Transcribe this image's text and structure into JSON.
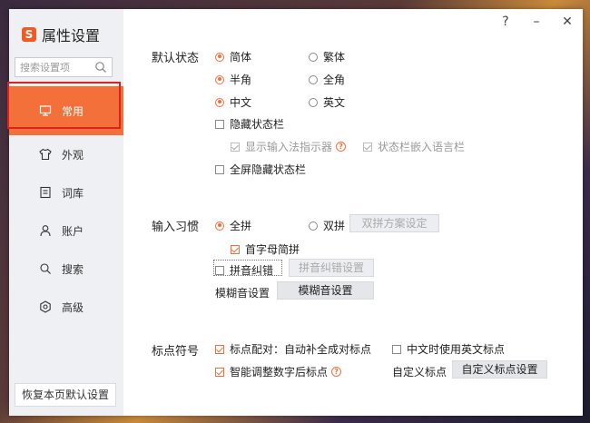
{
  "app": {
    "title": "属性设置",
    "logo_letter": "S"
  },
  "search": {
    "placeholder": "搜索设置项"
  },
  "sidebar": {
    "items": [
      {
        "label": "常用",
        "icon": "monitor-icon",
        "active": true
      },
      {
        "label": "外观",
        "icon": "shirt-icon"
      },
      {
        "label": "词库",
        "icon": "dictionary-icon"
      },
      {
        "label": "账户",
        "icon": "user-icon"
      },
      {
        "label": "搜索",
        "icon": "search-icon"
      },
      {
        "label": "高级",
        "icon": "gear-icon"
      }
    ],
    "restore_label": "恢复本页默认设置"
  },
  "titlebar": {
    "help": "?",
    "minimize": "–",
    "close": "✕"
  },
  "default_state": {
    "title": "默认状态",
    "simplified": "简体",
    "traditional": "繁体",
    "half_width": "半角",
    "full_width": "全角",
    "chinese": "中文",
    "english": "英文",
    "hide_status_bar": "隐藏状态栏",
    "show_indicator": "显示输入法指示器",
    "embed_language_bar": "状态栏嵌入语言栏",
    "fullscreen_hide": "全屏隐藏状态栏"
  },
  "input_habit": {
    "title": "输入习惯",
    "full_pinyin": "全拼",
    "double_pinyin": "双拼",
    "double_pinyin_settings": "双拼方案设定",
    "initial_abbrev": "首字母简拼",
    "pinyin_correction": "拼音纠错",
    "correction_settings": "拼音纠错设置",
    "fuzzy_label": "模糊音设置",
    "fuzzy_button": "模糊音设置"
  },
  "punctuation": {
    "title": "标点符号",
    "auto_pair": "标点配对：自动补全成对标点",
    "english_punct_in_chinese": "中文时使用英文标点",
    "smart_after_digit": "智能调整数字后标点",
    "custom_label": "自定义标点",
    "custom_button": "自定义标点设置"
  },
  "colors": {
    "accent": "#f3703a",
    "highlight_border": "#e0201f",
    "sidebar_bg": "#eef0f3"
  }
}
